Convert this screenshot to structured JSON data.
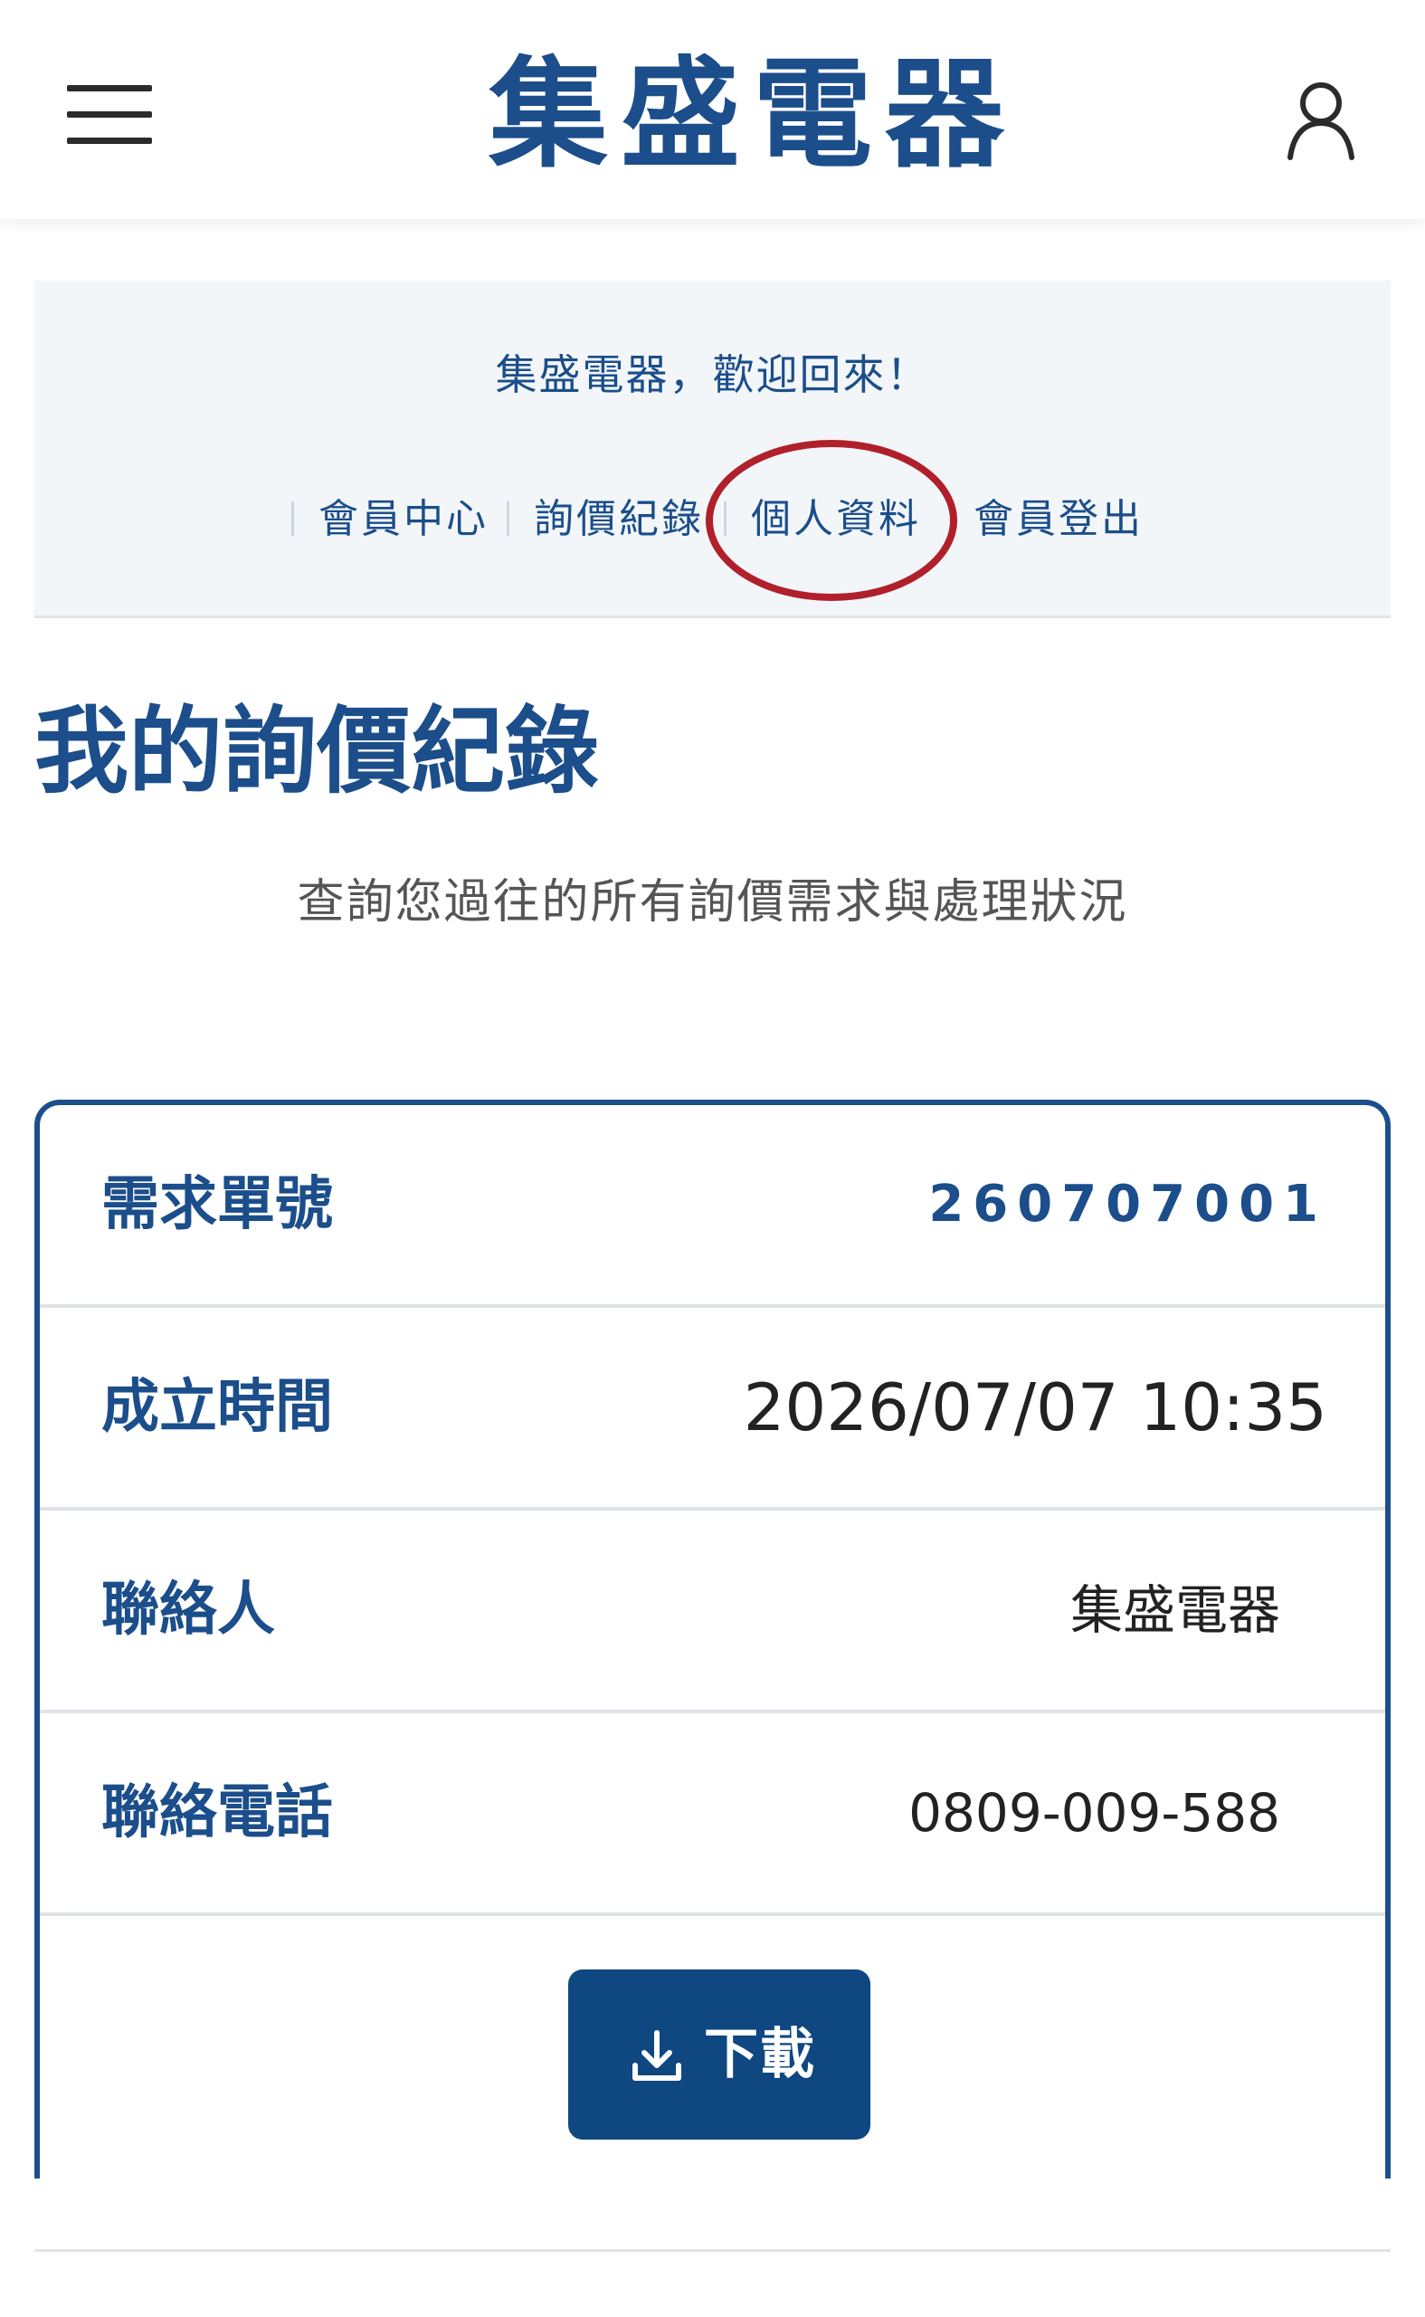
{
  "header": {
    "brand_name": "集盛電器",
    "menu_icon": "hamburger-menu-icon",
    "user_icon": "user-account-icon"
  },
  "welcome": {
    "message": "集盛電器，歡迎回來！",
    "nav": [
      {
        "label": "會員中心"
      },
      {
        "label": "詢價紀錄"
      },
      {
        "label": "個人資料",
        "highlighted": true
      },
      {
        "label": "會員登出"
      }
    ],
    "highlight_color": "#b0202b"
  },
  "page": {
    "title": "我的詢價紀錄",
    "subtitle": "查詢您過往的所有詢價需求與處理狀況"
  },
  "record": {
    "rows": [
      {
        "label": "需求單號",
        "value": "260707001"
      },
      {
        "label": "成立時間",
        "value": "2026/07/07 10:35"
      },
      {
        "label": "聯絡人",
        "value": "集盛電器"
      },
      {
        "label": "聯絡電話",
        "value": "0809-009-588"
      }
    ],
    "download_label": "下載",
    "download_icon": "download-icon"
  },
  "colors": {
    "brand": "#1b4e8a",
    "button": "#0f4780",
    "panel_bg": "#f3f6f9"
  }
}
